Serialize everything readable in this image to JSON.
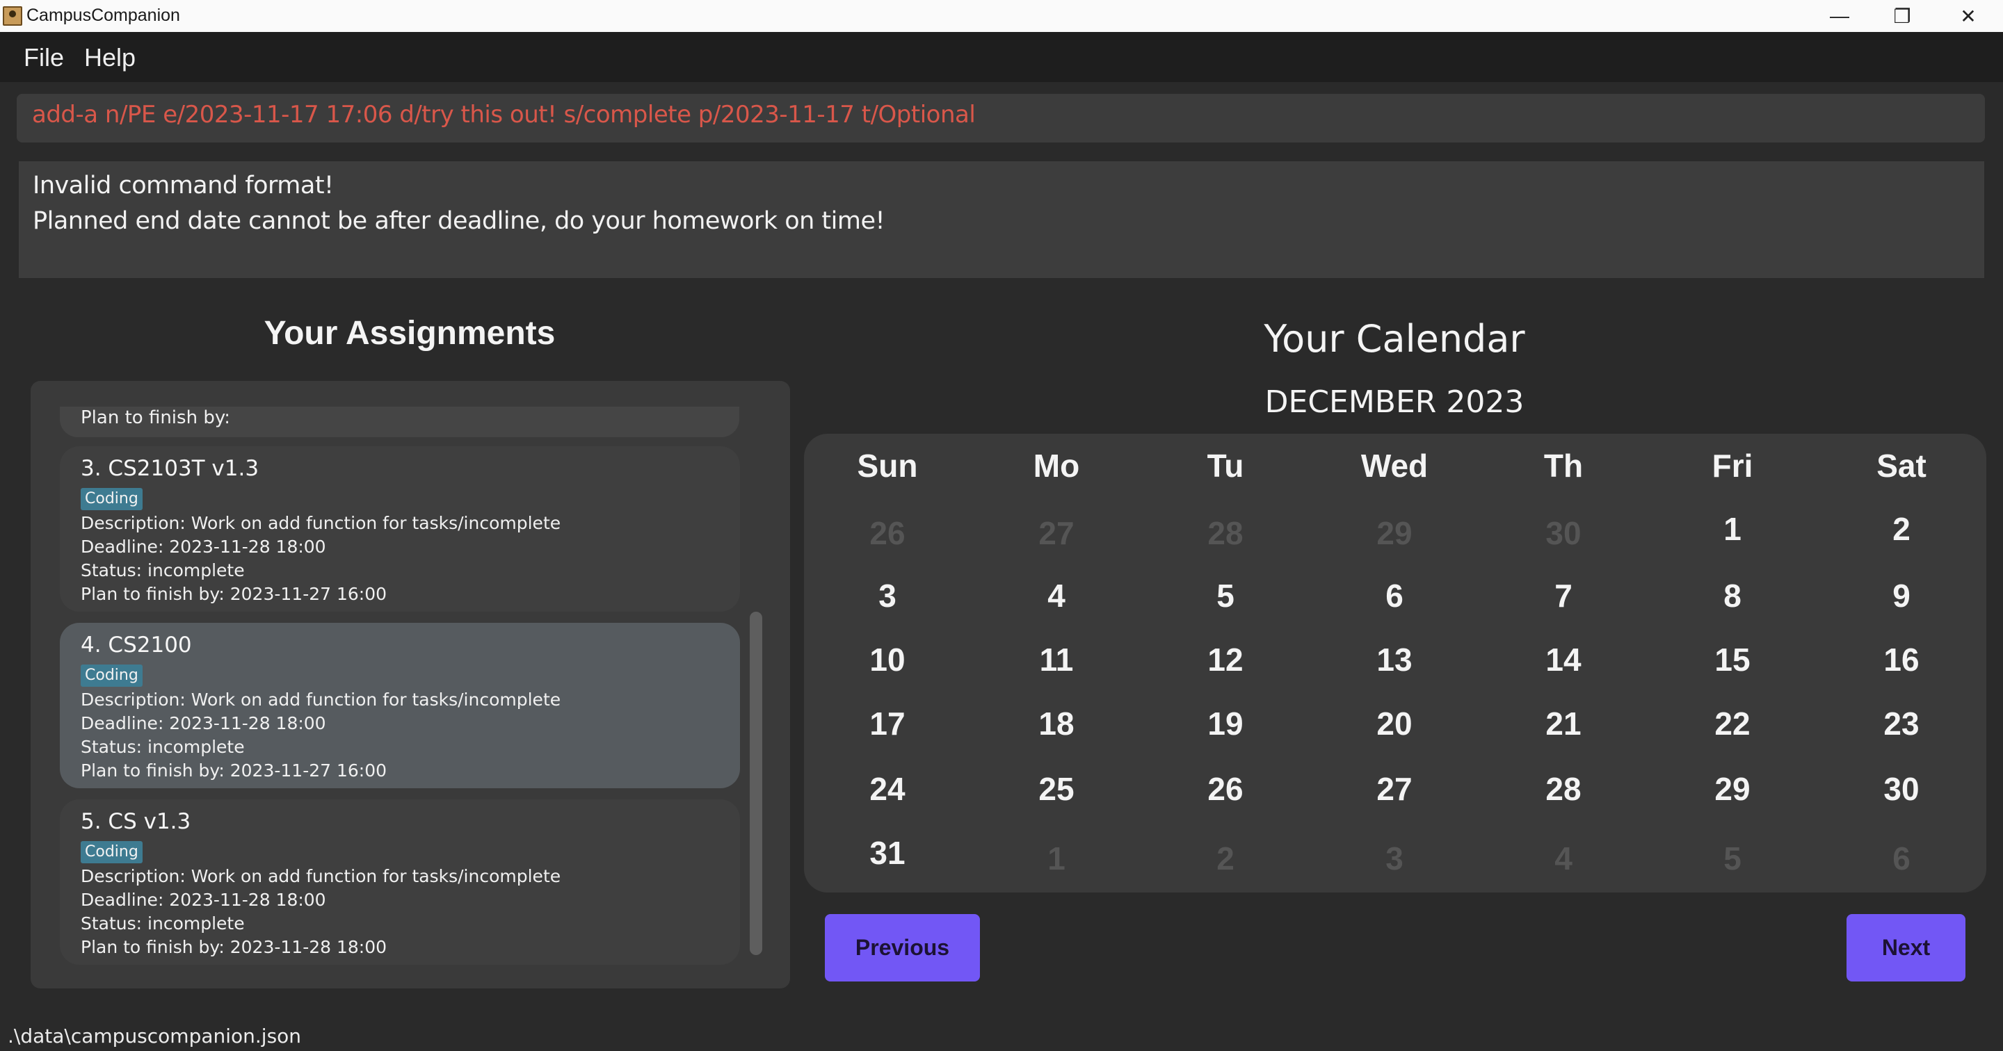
{
  "window": {
    "title": "CampusCompanion",
    "minimize_icon": "—",
    "maximize_icon": "❐",
    "close_icon": "✕"
  },
  "menu": {
    "items": [
      "File",
      "Help"
    ]
  },
  "command": {
    "value": "add-a n/PE e/2023-11-17 17:06 d/try this out! s/complete p/2023-11-17 t/Optional",
    "text_color": "#d9574a"
  },
  "result": {
    "lines": [
      "Invalid command format!",
      "Planned end date cannot be after deadline, do your homework on time!"
    ]
  },
  "assignments": {
    "heading": "Your Assignments",
    "partial_card_text": "Plan to finish by:",
    "cards": [
      {
        "title": "3.  CS2103T v1.3",
        "tag": "Coding",
        "description": "Description: Work on add function for tasks/incomplete",
        "deadline": "Deadline: 2023-11-28 18:00",
        "status": "Status: incomplete",
        "plan": "Plan to finish by: 2023-11-27 16:00",
        "selected": false
      },
      {
        "title": "4.  CS2100",
        "tag": "Coding",
        "description": "Description: Work on add function for tasks/incomplete",
        "deadline": "Deadline: 2023-11-28 18:00",
        "status": "Status: incomplete",
        "plan": "Plan to finish by: 2023-11-27 16:00",
        "selected": true
      },
      {
        "title": "5.  CS v1.3",
        "tag": "Coding",
        "description": "Description: Work on add function for tasks/incomplete",
        "deadline": "Deadline: 2023-11-28 18:00",
        "status": "Status: incomplete",
        "plan": "Plan to finish by: 2023-11-28 18:00",
        "selected": false
      }
    ]
  },
  "calendar": {
    "heading": "Your Calendar",
    "month_label": "DECEMBER 2023",
    "day_names": [
      "Sun",
      "Mo",
      "Tu",
      "Wed",
      "Th",
      "Fri",
      "Sat"
    ],
    "weeks": [
      [
        {
          "d": "26",
          "muted": true
        },
        {
          "d": "27",
          "muted": true
        },
        {
          "d": "28",
          "muted": true
        },
        {
          "d": "29",
          "muted": true
        },
        {
          "d": "30",
          "muted": true
        },
        {
          "d": "1",
          "muted": false
        },
        {
          "d": "2",
          "muted": false
        }
      ],
      [
        {
          "d": "3",
          "muted": false
        },
        {
          "d": "4",
          "muted": false
        },
        {
          "d": "5",
          "muted": false
        },
        {
          "d": "6",
          "muted": false
        },
        {
          "d": "7",
          "muted": false
        },
        {
          "d": "8",
          "muted": false
        },
        {
          "d": "9",
          "muted": false
        }
      ],
      [
        {
          "d": "10",
          "muted": false
        },
        {
          "d": "11",
          "muted": false
        },
        {
          "d": "12",
          "muted": false
        },
        {
          "d": "13",
          "muted": false
        },
        {
          "d": "14",
          "muted": false
        },
        {
          "d": "15",
          "muted": false
        },
        {
          "d": "16",
          "muted": false
        }
      ],
      [
        {
          "d": "17",
          "muted": false
        },
        {
          "d": "18",
          "muted": false
        },
        {
          "d": "19",
          "muted": false
        },
        {
          "d": "20",
          "muted": false
        },
        {
          "d": "21",
          "muted": false
        },
        {
          "d": "22",
          "muted": false
        },
        {
          "d": "23",
          "muted": false
        }
      ],
      [
        {
          "d": "24",
          "muted": false
        },
        {
          "d": "25",
          "muted": false
        },
        {
          "d": "26",
          "muted": false
        },
        {
          "d": "27",
          "muted": false
        },
        {
          "d": "28",
          "muted": false
        },
        {
          "d": "29",
          "muted": false
        },
        {
          "d": "30",
          "muted": false
        }
      ],
      [
        {
          "d": "31",
          "muted": false
        },
        {
          "d": "1",
          "muted": true
        },
        {
          "d": "2",
          "muted": true
        },
        {
          "d": "3",
          "muted": true
        },
        {
          "d": "4",
          "muted": true
        },
        {
          "d": "5",
          "muted": true
        },
        {
          "d": "6",
          "muted": true
        }
      ]
    ],
    "prev_label": "Previous",
    "next_label": "Next",
    "accent_color": "#7257f5"
  },
  "status_bar": {
    "path": ".\\data\\campuscompanion.json"
  }
}
